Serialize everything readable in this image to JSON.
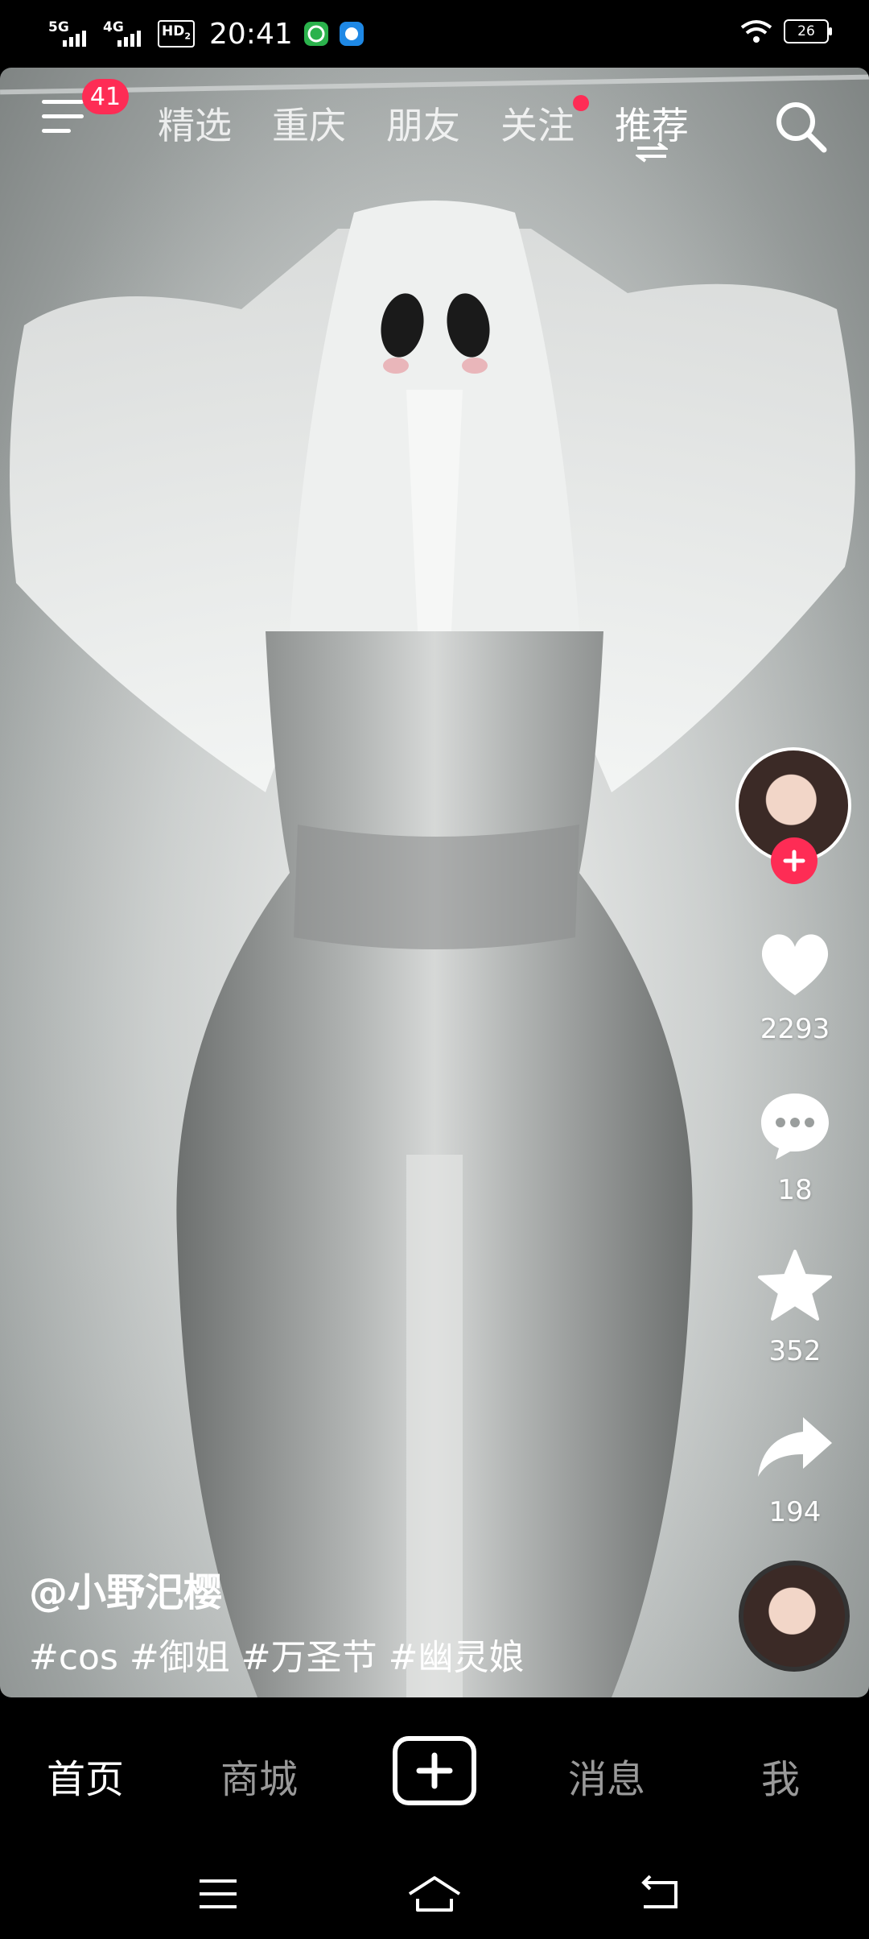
{
  "status_bar": {
    "network1": "5G",
    "network2": "4G",
    "hd_label": "HD",
    "hd_sub": "2",
    "time": "20:41",
    "battery": "26"
  },
  "top_nav": {
    "menu_badge": "41",
    "tabs": [
      {
        "label": "精选"
      },
      {
        "label": "重庆"
      },
      {
        "label": "朋友"
      },
      {
        "label": "关注"
      },
      {
        "label": "推荐"
      }
    ],
    "active_tab": "推荐"
  },
  "actions": {
    "likes": "2293",
    "comments": "18",
    "favorites": "352",
    "shares": "194"
  },
  "caption": {
    "author": "@小野汜樱",
    "tags": "#cos #御姐 #万圣节 #幽灵娘"
  },
  "bottom_nav": {
    "items": [
      {
        "label": "首页"
      },
      {
        "label": "商城"
      },
      {
        "label": "消息"
      },
      {
        "label": "我"
      }
    ]
  },
  "colors": {
    "accent": "#fe2c55",
    "background": "#000000"
  },
  "icons": [
    "menu-icon",
    "search-icon",
    "swap-icon",
    "heart-icon",
    "comment-icon",
    "star-icon",
    "share-icon",
    "plus-icon",
    "system-menu-icon",
    "system-home-icon",
    "system-back-icon"
  ]
}
